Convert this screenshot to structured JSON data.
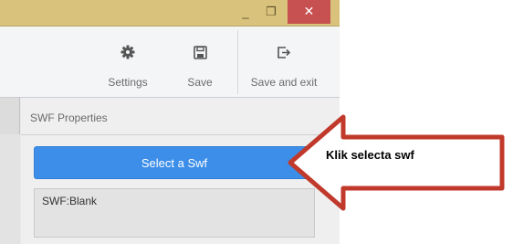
{
  "titlebar": {
    "minimize_glyph": "_",
    "maximize_glyph": "❐",
    "close_glyph": "✕",
    "close_color": "#c75050"
  },
  "toolbar": {
    "settings_label": "Settings",
    "save_label": "Save",
    "save_exit_label": "Save and exit",
    "icons": [
      "gear-icon",
      "floppy-disk-icon",
      "exit-icon"
    ]
  },
  "properties": {
    "title": "SWF Properties",
    "select_button_label": "Select a Swf",
    "swf_value": "SWF:Blank",
    "accent_color": "#3d8ee8"
  },
  "annotation": {
    "text": "Klik selecta swf",
    "arrow_color": "#c0392b"
  }
}
